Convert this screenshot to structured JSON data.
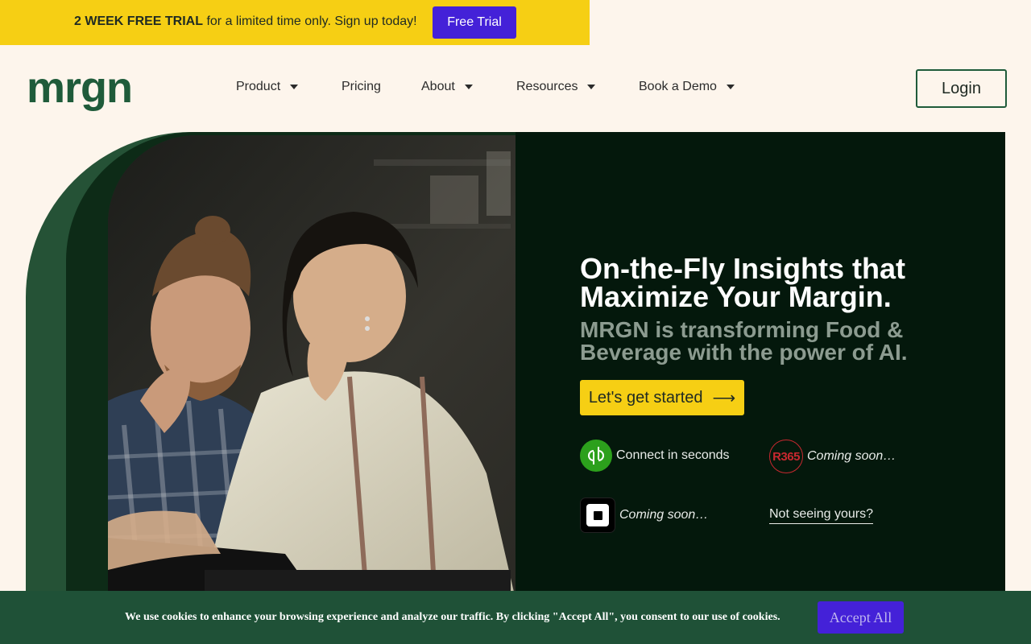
{
  "promo": {
    "bold_text": "2 WEEK FREE TRIAL",
    "text": " for a limited time only. Sign up today!",
    "button_label": "Free Trial"
  },
  "header": {
    "logo_text": "mrgn",
    "nav": [
      {
        "label": "Product",
        "has_dropdown": true
      },
      {
        "label": "Pricing",
        "has_dropdown": false
      },
      {
        "label": "About",
        "has_dropdown": true
      },
      {
        "label": "Resources",
        "has_dropdown": true
      },
      {
        "label": "Book a Demo",
        "has_dropdown": true
      }
    ],
    "login_label": "Login"
  },
  "hero": {
    "title": "On-the-Fly Insights that Maximize Your Margin.",
    "subtitle": "MRGN is transforming Food & Beverage with the power of AI.",
    "cta_label": "Let's get started",
    "cta_arrow": "⟶",
    "integrations": [
      {
        "icon": "quickbooks-icon",
        "text": "Connect in seconds"
      },
      {
        "icon": "r365-icon",
        "text": "Coming soon…",
        "icon_text": "R365"
      },
      {
        "icon": "square-icon",
        "text": "Coming soon…"
      }
    ],
    "not_seeing_label": "Not seeing yours?"
  },
  "cookie": {
    "text": "We use cookies to enhance your browsing experience and analyze our traffic.  By clicking \"Accept All\", you consent to our use of cookies.",
    "accept_label": "Accept All"
  },
  "colors": {
    "brand_green": "#1f5b3a",
    "promo_yellow": "#f6cf14",
    "button_purple": "#4421d8",
    "hero_dark": "#04180c",
    "page_bg": "#fdf5ec"
  }
}
